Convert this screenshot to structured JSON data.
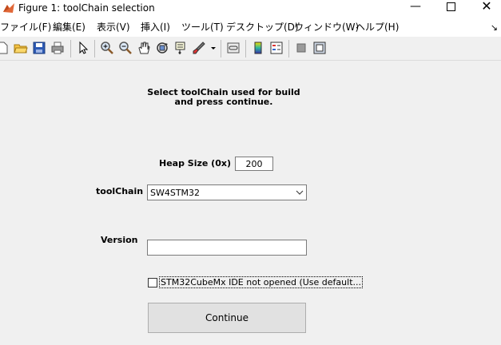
{
  "window": {
    "title": "Figure 1: toolChain selection",
    "minimize": "—",
    "close": "✕"
  },
  "menubar": {
    "items": [
      {
        "label": "ファイル(F)"
      },
      {
        "label": "編集(E)"
      },
      {
        "label": "表示(V)"
      },
      {
        "label": "挿入(I)"
      },
      {
        "label": "ツール(T)"
      },
      {
        "label": "デスクトップ(D)"
      },
      {
        "label": "ウィンドウ(W)"
      },
      {
        "label": "ヘルプ(H)"
      }
    ],
    "overflow": "↘"
  },
  "toolbar": {
    "icons": [
      "new-figure-icon",
      "open-file-icon",
      "save-icon",
      "print-icon",
      "pointer-icon",
      "zoom-in-icon",
      "zoom-out-icon",
      "pan-hand-icon",
      "rotate-3d-icon",
      "data-cursor-icon",
      "brush-icon",
      "brush-dropdown-icon",
      "link-plot-icon",
      "colorbar-icon",
      "legend-icon",
      "hide-plot-tools-icon",
      "show-plot-tools-icon"
    ]
  },
  "form": {
    "instruction": "Select toolChain used for build\nand press continue.",
    "heap_label": "Heap Size (0x)",
    "heap_value": "200",
    "toolchain_label": "toolChain",
    "toolchain_selected": "SW4STM32",
    "version_label": "Version",
    "version_value": "",
    "checkbox_label": "STM32CubeMx IDE not opened (Use default...",
    "checkbox_checked": false,
    "continue_label": "Continue"
  },
  "colors": {
    "background": "#f0f0f0",
    "button_face": "#e1e1e1"
  }
}
